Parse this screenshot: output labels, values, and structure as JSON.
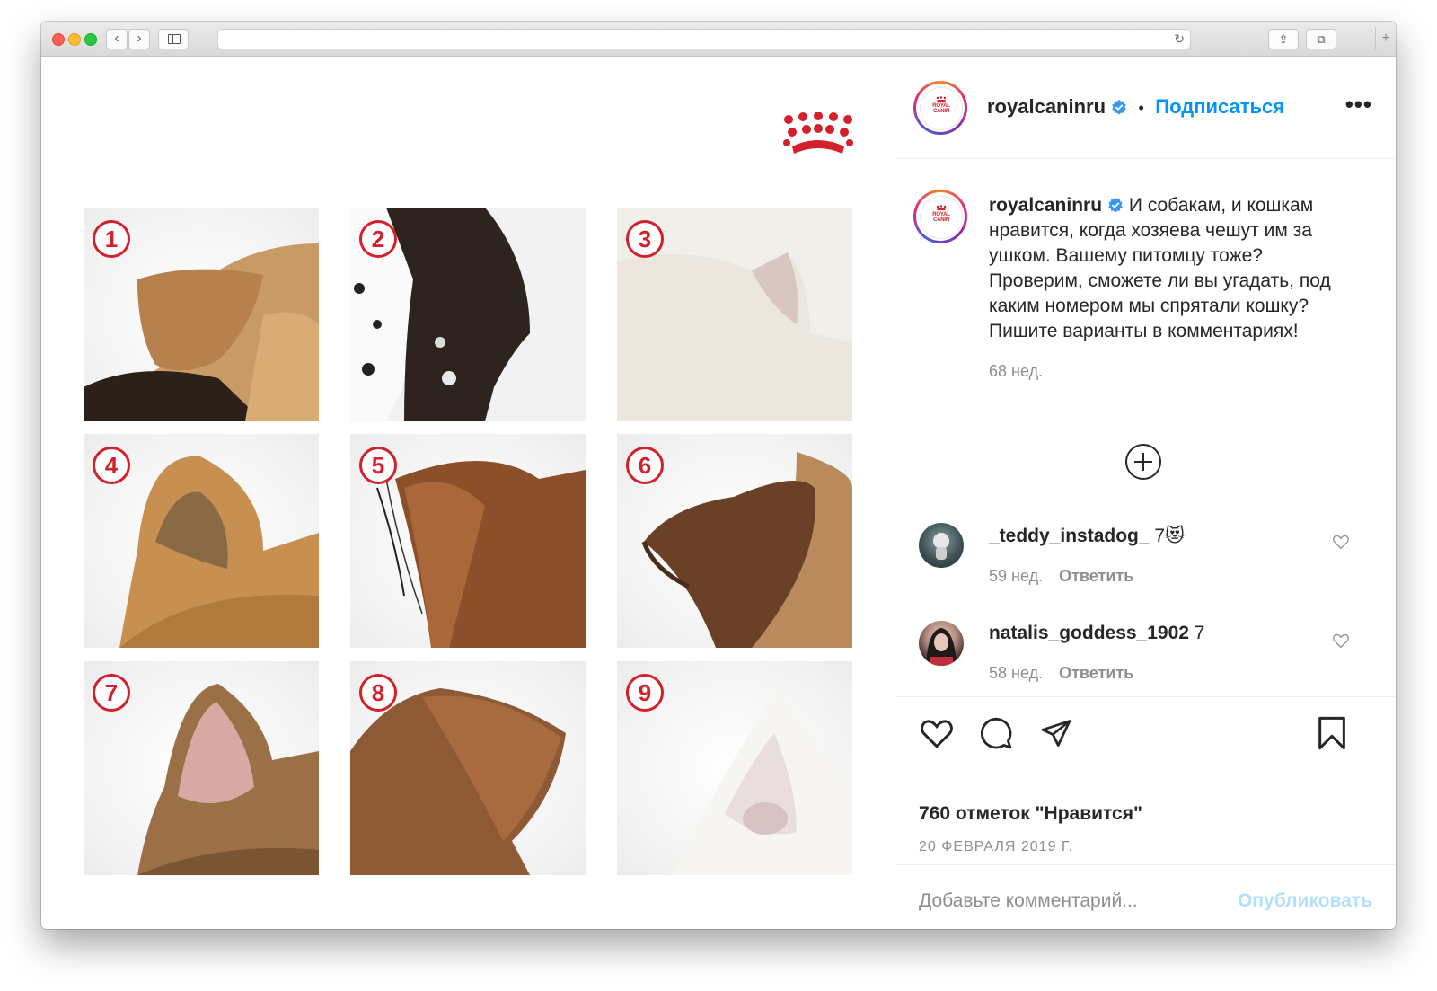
{
  "browser": {
    "back_glyph": "‹",
    "forward_glyph": "›",
    "reload_glyph": "↻",
    "share_glyph": "⇪",
    "tabs_glyph": "⧉",
    "newtab_glyph": "+"
  },
  "post": {
    "tile_numbers": [
      "1",
      "2",
      "3",
      "4",
      "5",
      "6",
      "7",
      "8",
      "9"
    ]
  },
  "header": {
    "username": "royalcaninru",
    "separator": "•",
    "follow_label": "Подписаться",
    "more_label": "•••",
    "avatar_text": "ROYAL CANIN"
  },
  "caption": {
    "username": "royalcaninru",
    "text": "И собакам, и кошкам нравится, когда хозяева чешут им за ушком. Вашему питомцу тоже? Проверим, сможете ли вы угадать, под каким номером мы спрятали кошку? Пишите варианты в комментариях!",
    "time": "68 нед."
  },
  "comments": [
    {
      "username": "_teddy_instadog_",
      "text": "7",
      "emoji": "😻",
      "time": "59 нед.",
      "reply": "Ответить"
    },
    {
      "username": "natalis_goddess_1902",
      "text": "7",
      "emoji": "",
      "time": "58 нед.",
      "reply": "Ответить"
    }
  ],
  "actions": {
    "likes": "760 отметок \"Нравится\"",
    "date": "20 ФЕВРАЛЯ 2019 Г.",
    "comment_placeholder": "Добавьте комментарий...",
    "publish_label": "Опубликовать"
  },
  "colors": {
    "brand_red": "#d4202a",
    "link_blue": "#0095f6",
    "publish_disabled": "#b2dffc"
  }
}
